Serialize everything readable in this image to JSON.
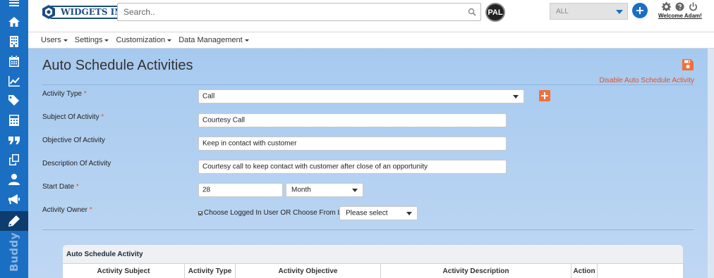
{
  "sidebar": {
    "items": [
      {
        "name": "menu-icon"
      },
      {
        "name": "home-icon"
      },
      {
        "name": "building-icon"
      },
      {
        "name": "calendar-icon"
      },
      {
        "name": "line-chart-icon"
      },
      {
        "name": "tags-icon"
      },
      {
        "name": "calculator-icon"
      },
      {
        "name": "quote-icon"
      },
      {
        "name": "copy-icon"
      },
      {
        "name": "user-icon"
      },
      {
        "name": "megaphone-icon"
      },
      {
        "name": "pencil-icon",
        "active": true
      }
    ],
    "brand": "Buddy"
  },
  "header": {
    "logo_text": "WIDGETS INC.",
    "search_placeholder": "Search..",
    "pal_label": "PAL",
    "filter_value": "ALL",
    "welcome": "Welcome Adam!"
  },
  "menu": {
    "items": [
      {
        "label": "Users"
      },
      {
        "label": "Settings"
      },
      {
        "label": "Customization"
      },
      {
        "label": "Data Management"
      }
    ]
  },
  "page": {
    "title": "Auto Schedule Activities",
    "disable_link": "Disable Auto Schedule Activity"
  },
  "form": {
    "activity_type": {
      "label": "Activity Type",
      "required": "*",
      "value": "Call"
    },
    "subject": {
      "label": "Subject Of Activity",
      "required": "*",
      "value": "Courtesy Call"
    },
    "objective": {
      "label": "Objective Of Activity",
      "value": "Keep in contact with customer"
    },
    "description": {
      "label": "Description Of Activity",
      "value": "Courtesy call to keep contact with customer after close of an opportunity"
    },
    "start_date": {
      "label": "Start Date",
      "required": "*",
      "value": "28",
      "unit": "Month"
    },
    "owner": {
      "label": "Activity Owner",
      "required": "*",
      "checkbox_label": "Choose Logged In User OR Choose From List",
      "checked": true,
      "select_placeholder": "Please select"
    }
  },
  "table": {
    "title": "Auto Schedule Activity",
    "columns": [
      "Activity Subject",
      "Activity Type",
      "Activity Objective",
      "Activity Description",
      "Action"
    ]
  },
  "colors": {
    "sidebar": "#1b6fc2",
    "sidebar_active": "#0d3d6e",
    "accent_orange": "#e0522b",
    "add_button": "#f26f3a"
  }
}
